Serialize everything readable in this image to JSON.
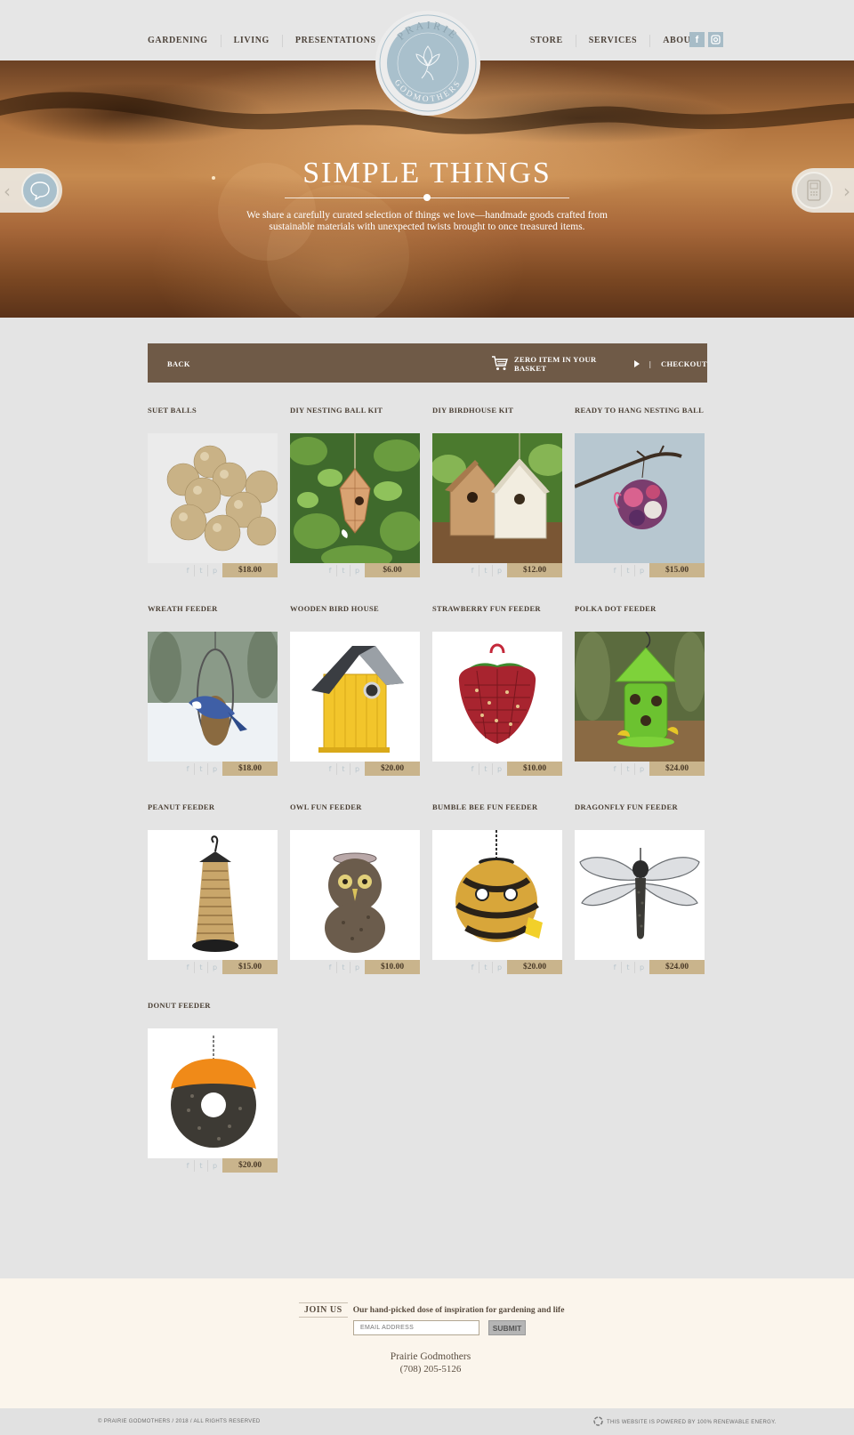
{
  "header": {
    "nav_left": [
      "GARDENING",
      "LIVING",
      "PRESENTATIONS"
    ],
    "nav_right": [
      "STORE",
      "SERVICES",
      "ABOUT"
    ],
    "logo_top_text": "PRAIRIE",
    "logo_bottom_text": "GODMOTHERS",
    "social": [
      "f",
      "instagram"
    ]
  },
  "hero": {
    "title": "SIMPLE THINGS",
    "text": "We share a carefully curated selection of things we love—handmade goods crafted from sustainable materials with unexpected twists brought to once treasured items."
  },
  "shopbar": {
    "back": "BACK",
    "basket": "ZERO ITEM IN YOUR BASKET",
    "separator": "|",
    "checkout": "CHECKOUT"
  },
  "share_icons": [
    "f",
    "t",
    "p"
  ],
  "products": [
    {
      "title": "SUET BALLS",
      "price": "$18.00",
      "image": "suet-balls"
    },
    {
      "title": "DIY NESTING BALL KIT",
      "price": "$6.00",
      "image": "nesting-ball-kit"
    },
    {
      "title": "DIY BIRDHOUSE KIT",
      "price": "$12.00",
      "image": "birdhouse-kit"
    },
    {
      "title": "READY TO HANG NESTING BALL",
      "price": "$15.00",
      "image": "nesting-ball"
    },
    {
      "title": "WREATH FEEDER",
      "price": "$18.00",
      "image": "wreath-feeder"
    },
    {
      "title": "WOODEN BIRD HOUSE",
      "price": "$20.00",
      "image": "wooden-bird-house"
    },
    {
      "title": "STRAWBERRY FUN FEEDER",
      "price": "$10.00",
      "image": "strawberry-feeder"
    },
    {
      "title": "POLKA DOT FEEDER",
      "price": "$24.00",
      "image": "polka-dot-feeder"
    },
    {
      "title": "PEANUT FEEDER",
      "price": "$15.00",
      "image": "peanut-feeder"
    },
    {
      "title": "OWL FUN FEEDER",
      "price": "$10.00",
      "image": "owl-feeder"
    },
    {
      "title": "BUMBLE BEE FUN FEEDER",
      "price": "$20.00",
      "image": "bumble-bee-feeder"
    },
    {
      "title": "DRAGONFLY FUN FEEDER",
      "price": "$24.00",
      "image": "dragonfly-feeder"
    },
    {
      "title": "DONUT FEEDER",
      "price": "$20.00",
      "image": "donut-feeder"
    }
  ],
  "footer": {
    "join_badge": "JOIN US",
    "join_tagline": "Our hand-picked dose of inspiration for gardening and life",
    "email_placeholder": "EMAIL ADDRESS",
    "submit": "SUBMIT",
    "company": "Prairie Godmothers",
    "phone": "(708) 205-5126",
    "copyright": "© PRAIRIE GODMOTHERS / 2018 / ALL RIGHTS RESERVED",
    "eco": "THIS WEBSITE IS POWERED BY 100% RENEWABLE ENERGY."
  },
  "colors": {
    "accent_blue": "#a9c0cc",
    "bar_brown": "#6f5a47",
    "price_tan": "#c9b48c",
    "footer_cream": "#fbf5ec"
  }
}
